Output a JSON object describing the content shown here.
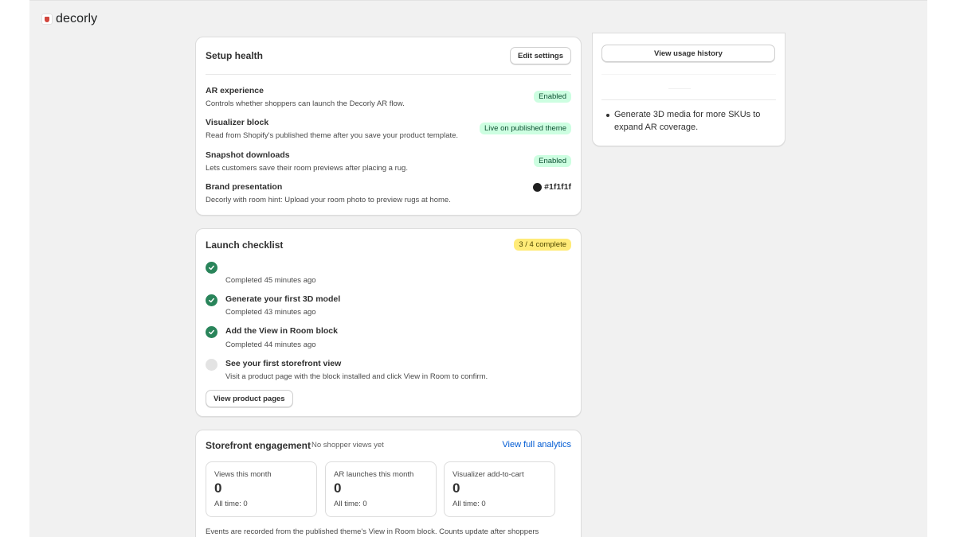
{
  "app": {
    "brand": "decorly"
  },
  "setup_health": {
    "title": "Setup health",
    "edit_label": "Edit settings",
    "rows": [
      {
        "title": "AR experience",
        "desc": "Controls whether shoppers can launch the Decorly AR flow.",
        "status": "Enabled"
      },
      {
        "title": "Visualizer block",
        "desc": "Read from Shopify's published theme after you save your product template.",
        "status": "Live on published theme"
      },
      {
        "title": "Snapshot downloads",
        "desc": "Lets customers save their room previews after placing a rug.",
        "status": "Enabled"
      },
      {
        "title": "Brand presentation",
        "desc": "Decorly with room hint: Upload your room photo to preview rugs at home.",
        "color_label": "#1f1f1f",
        "color": "#1f1f1f"
      }
    ]
  },
  "checklist": {
    "title": "Launch checklist",
    "progress": "3 / 4 complete",
    "steps": [
      {
        "title": "",
        "desc": "Completed 45 minutes ago",
        "done": true
      },
      {
        "title": "Generate your first 3D model",
        "desc": "Completed 43 minutes ago",
        "done": true
      },
      {
        "title": "Add the View in Room block",
        "desc": "Completed 44 minutes ago",
        "done": true
      },
      {
        "title": "See your first storefront view",
        "desc": "Visit a product page with the block installed and click View in Room to confirm.",
        "done": false
      }
    ],
    "action_label": "View product pages"
  },
  "engagement": {
    "title": "Storefront engagement",
    "note": "No shopper views yet",
    "link": "View full analytics",
    "metrics": [
      {
        "label": "Views this month",
        "value": "0",
        "all": "All time: 0"
      },
      {
        "label": "AR launches this month",
        "value": "0",
        "all": "All time: 0"
      },
      {
        "label": "Visualizer add-to-cart",
        "value": "0",
        "all": "All time: 0"
      }
    ],
    "footer": "Events are recorded from the published theme's View in Room block. Counts update after shoppers"
  },
  "sidebar": {
    "usage_label": "View usage history",
    "tip": "Generate 3D media for more SKUs to expand AR coverage."
  },
  "colors": {
    "accent": "#005bd3",
    "success": "#29845a",
    "badge_success_bg": "#cdfee1",
    "badge_warning_bg": "#ffeb78"
  }
}
